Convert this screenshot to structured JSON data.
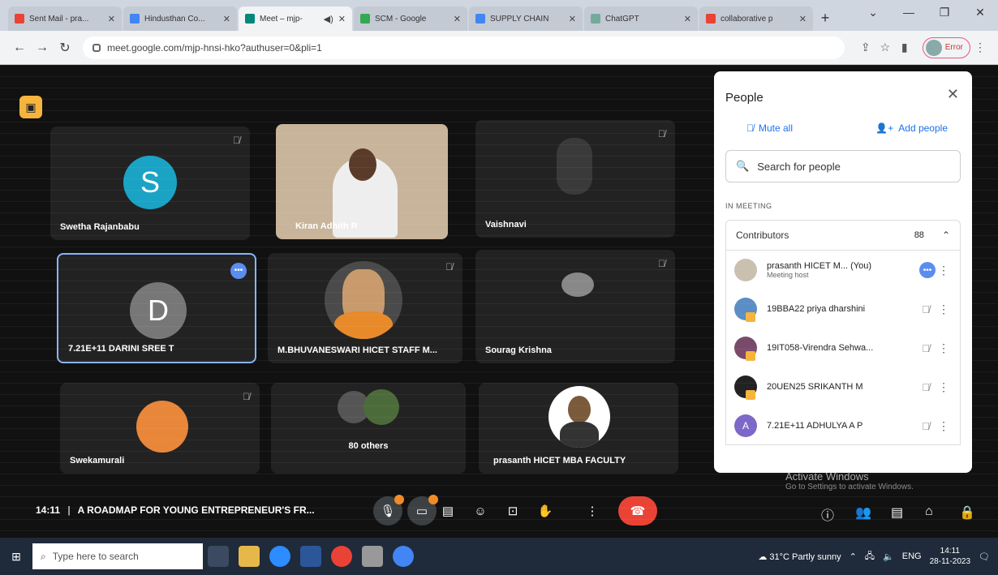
{
  "browser": {
    "tabs": [
      {
        "title": "Sent Mail - pra...",
        "favicon_color": "#ea4335",
        "active": false
      },
      {
        "title": "Hindusthan Co...",
        "favicon_color": "#4285f4",
        "active": false
      },
      {
        "title": "Meet – mjp-",
        "favicon_color": "#00897b",
        "active": true
      },
      {
        "title": "SCM - Google",
        "favicon_color": "#34a853",
        "active": false
      },
      {
        "title": "SUPPLY CHAIN",
        "favicon_color": "#4285f4",
        "active": false
      },
      {
        "title": "ChatGPT",
        "favicon_color": "#74aa9c",
        "active": false
      },
      {
        "title": "collaborative p",
        "favicon_color": "#ea4335",
        "active": false
      }
    ],
    "url": "meet.google.com/mjp-hnsi-hko?authuser=0&pli=1",
    "profile_label": "Error"
  },
  "meet": {
    "tiles": [
      {
        "name": "Swetha Rajanbabu",
        "initial": "S",
        "color": "#1aa3c4"
      },
      {
        "name": "Kiran Adhith R"
      },
      {
        "name": "Vaishnavi"
      },
      {
        "name": "7.21E+11 DARINI SREE T",
        "initial": "D",
        "color": "#777777"
      },
      {
        "name": "M.BHUVANESWARI HICET STAFF M..."
      },
      {
        "name": "Sourag Krishna"
      },
      {
        "name": "Swekamurali"
      },
      {
        "name": "80 others"
      },
      {
        "name": "prasanth HICET MBA FACULTY"
      }
    ],
    "meeting_time": "14:11",
    "meeting_title": "A ROADMAP FOR YOUNG ENTREPRENEUR'S FR...",
    "activate_windows": "Activate Windows",
    "activate_sub": "Go to Settings to activate Windows."
  },
  "people_panel": {
    "title": "People",
    "mute_all": "Mute all",
    "add_people": "Add people",
    "search_placeholder": "Search for people",
    "section_label": "IN MEETING",
    "group_label": "Contributors",
    "group_count": "88",
    "people": [
      {
        "name": "prasanth HICET M...",
        "you": "(You)",
        "role": "Meeting host",
        "color": "#c9c0b0"
      },
      {
        "name": "19BBA22 priya dharshini",
        "color": "#5b8ec4"
      },
      {
        "name": "19IT058-Virendra Sehwa...",
        "color": "#7a4a6a"
      },
      {
        "name": "20UEN25 SRIKANTH M",
        "color": "#222222"
      },
      {
        "name": "7.21E+11 ADHULYA A P",
        "initial": "A",
        "color": "#7b68c8"
      }
    ]
  },
  "taskbar": {
    "search_placeholder": "Type here to search",
    "weather": "31°C  Partly sunny",
    "lang": "ENG",
    "time": "14:11",
    "date": "28-11-2023"
  }
}
